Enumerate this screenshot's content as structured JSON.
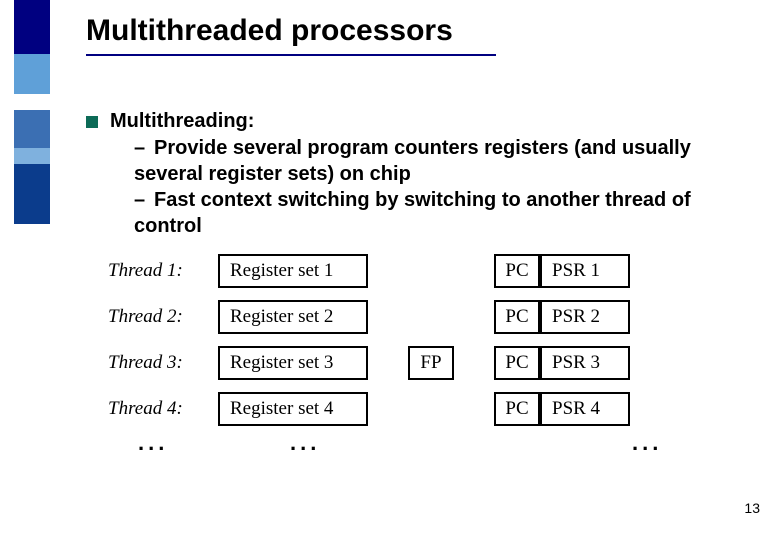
{
  "slide": {
    "title": "Multithreaded processors",
    "page_number": "13",
    "bullet_heading": "Multithreading:",
    "sub_items": [
      "Provide several program counters registers (and usually several register sets) on chip",
      "Fast context switching by switching to another thread of control"
    ],
    "ellipsis": "..."
  },
  "threads": [
    {
      "label": "Thread 1:",
      "regset": "Register set 1",
      "pc": "PC",
      "psr": "PSR 1",
      "fp": ""
    },
    {
      "label": "Thread 2:",
      "regset": "Register set 2",
      "pc": "PC",
      "psr": "PSR 2",
      "fp": ""
    },
    {
      "label": "Thread 3:",
      "regset": "Register set 3",
      "pc": "PC",
      "psr": "PSR 3",
      "fp": "FP"
    },
    {
      "label": "Thread 4:",
      "regset": "Register set 4",
      "pc": "PC",
      "psr": "PSR 4",
      "fp": ""
    }
  ]
}
